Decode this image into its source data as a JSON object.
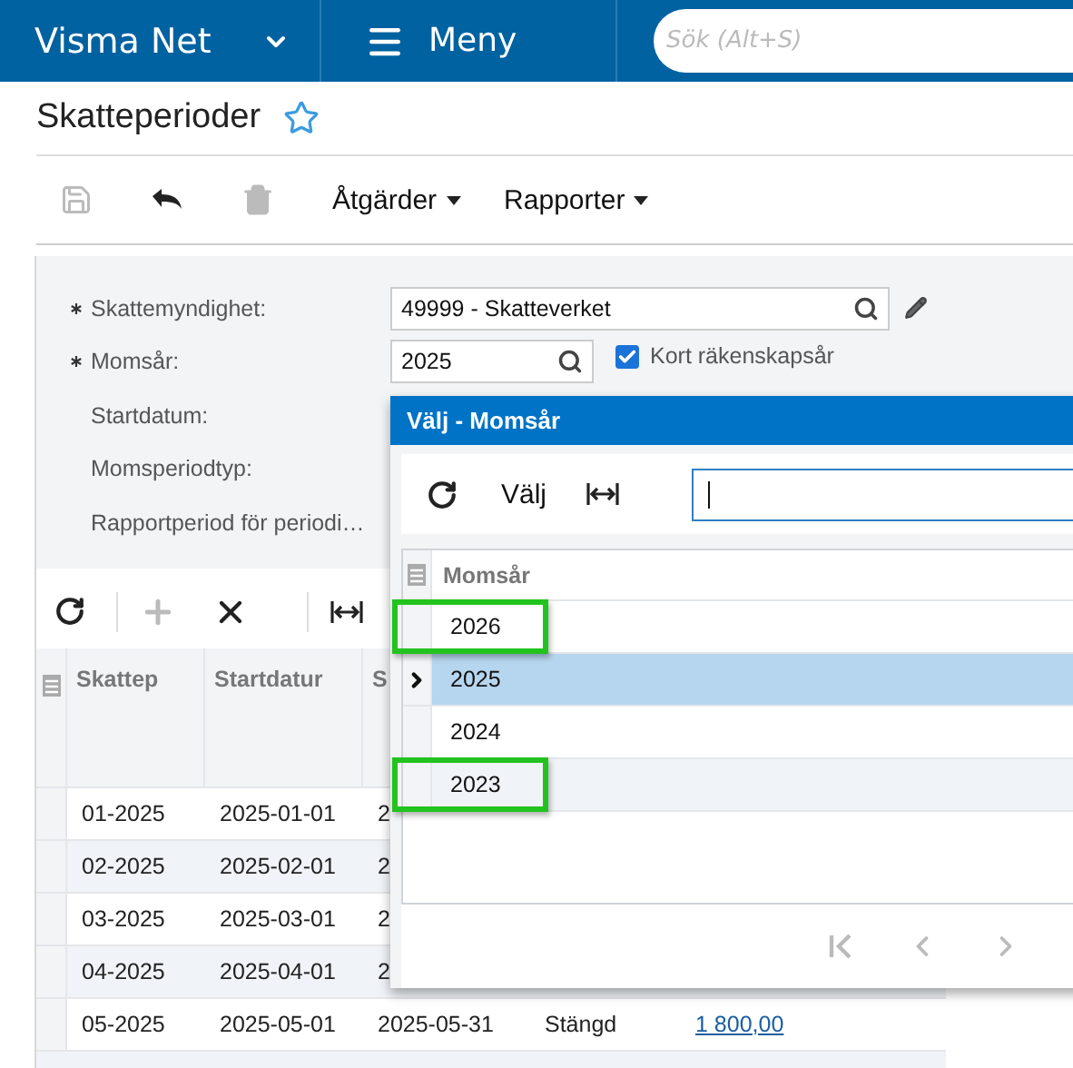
{
  "top_bar": {
    "brand": "Visma Net",
    "menu": "Meny",
    "search": {
      "placeholder": "Sök (Alt+S)"
    }
  },
  "page": {
    "title": "Skatteperioder",
    "favorite": false
  },
  "toolbar": {
    "actions": [
      {
        "kind": "save",
        "disabled": true
      },
      {
        "kind": "undo",
        "disabled": false
      },
      {
        "kind": "delete",
        "disabled": true
      }
    ],
    "menus": [
      "Åtgärder",
      "Rapporter"
    ]
  },
  "form": {
    "fields": [
      {
        "label": "Skattemyndighet:",
        "required": true,
        "kind": "lookup_edit",
        "value": "49999 - Skatteverket"
      },
      {
        "label": "Momsår:",
        "required": true,
        "kind": "lookup_check",
        "value": "2025",
        "checkbox": {
          "label": "Kort räkenskapsår",
          "checked": true
        }
      },
      {
        "label": "Startdatum:",
        "required": false,
        "kind": "covered"
      },
      {
        "label": "Momsperiodtyp:",
        "required": false,
        "kind": "covered"
      },
      {
        "label": "Rapportperiod för periodi…",
        "required": false,
        "kind": "covered"
      }
    ]
  },
  "grid": {
    "actions": [
      {
        "kind": "refresh",
        "disabled": false
      },
      {
        "kind": "add",
        "disabled": true
      },
      {
        "kind": "delete",
        "disabled": false
      },
      {
        "kind": "fit",
        "disabled": false
      }
    ],
    "columns": [
      "Skattep",
      "Startdatur",
      "S"
    ],
    "rows": [
      {
        "period": "01-2025",
        "start": "2025-01-01",
        "end": "2"
      },
      {
        "period": "02-2025",
        "start": "2025-02-01",
        "end": "2"
      },
      {
        "period": "03-2025",
        "start": "2025-03-01",
        "end": "2"
      },
      {
        "period": "04-2025",
        "start": "2025-04-01",
        "end": "2"
      },
      {
        "period": "05-2025",
        "start": "2025-05-01",
        "end": "2025-05-31",
        "status": "Stängd",
        "amount": "1 800,00"
      }
    ]
  },
  "popup": {
    "title": "Välj - Momsår",
    "select": "Välj",
    "search": {
      "focused": true
    },
    "column": "Momsår",
    "rows": [
      {
        "year": "2026",
        "selected": false,
        "highlighted": true
      },
      {
        "year": "2025",
        "selected": true,
        "highlighted": false
      },
      {
        "year": "2024",
        "selected": false,
        "highlighted": false
      },
      {
        "year": "2023",
        "selected": false,
        "highlighted": true
      }
    ]
  }
}
